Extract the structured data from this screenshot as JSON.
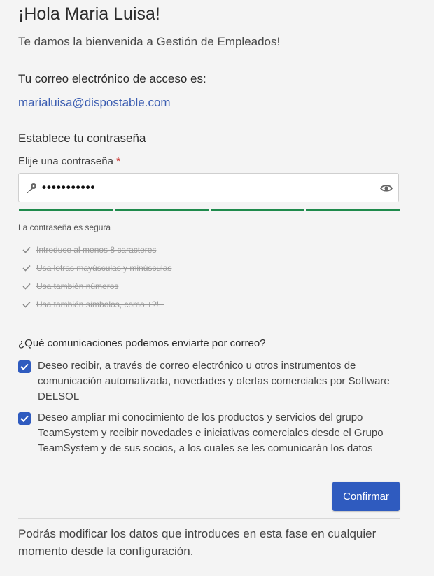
{
  "header": {
    "greeting": "¡Hola Maria Luisa!",
    "welcome": "Te damos la bienvenida a Gestión de Empleados!"
  },
  "access": {
    "label": "Tu correo electrónico de acceso es:",
    "email": "marialuisa@dispostable.com"
  },
  "password": {
    "section_title": "Establece tu contraseña",
    "field_label": "Elije una contraseña",
    "required_mark": "*",
    "value": "•••••••••••",
    "strength_segments": 4,
    "strength_text": "La contraseña es segura",
    "rules": [
      "Introduce al menos 8 caracteres",
      "Usa letras mayúsculas y minúsculas",
      "Usa también números",
      "Usa también símbolos, como +?!~"
    ]
  },
  "communications": {
    "title": "¿Qué comunicaciones podemos enviarte por correo?",
    "options": [
      {
        "checked": true,
        "text": "Deseo recibir, a través de correo electrónico u otros instrumentos de comunicación automatizada, novedades y ofertas comerciales por Software DELSOL"
      },
      {
        "checked": true,
        "text": "Deseo ampliar mi conocimiento de los productos y servicios del grupo TeamSystem y recibir novedades e iniciativas comerciales desde el Grupo TeamSystem y de sus socios, a los cuales se les comunicarán los datos"
      }
    ]
  },
  "actions": {
    "confirm_label": "Confirmar"
  },
  "footer": {
    "note": "Podrás modificar los datos que introduces en esta fase en cualquier momento desde la configuración."
  },
  "colors": {
    "accent": "#2f5bbf",
    "link": "#3b5db1",
    "strength": "#1f8a4c",
    "required": "#c9302c"
  },
  "icons": {
    "password_prefix": "key-icon",
    "password_toggle": "eye-icon",
    "rule_status": "check-icon",
    "checkbox_mark": "check-icon"
  }
}
